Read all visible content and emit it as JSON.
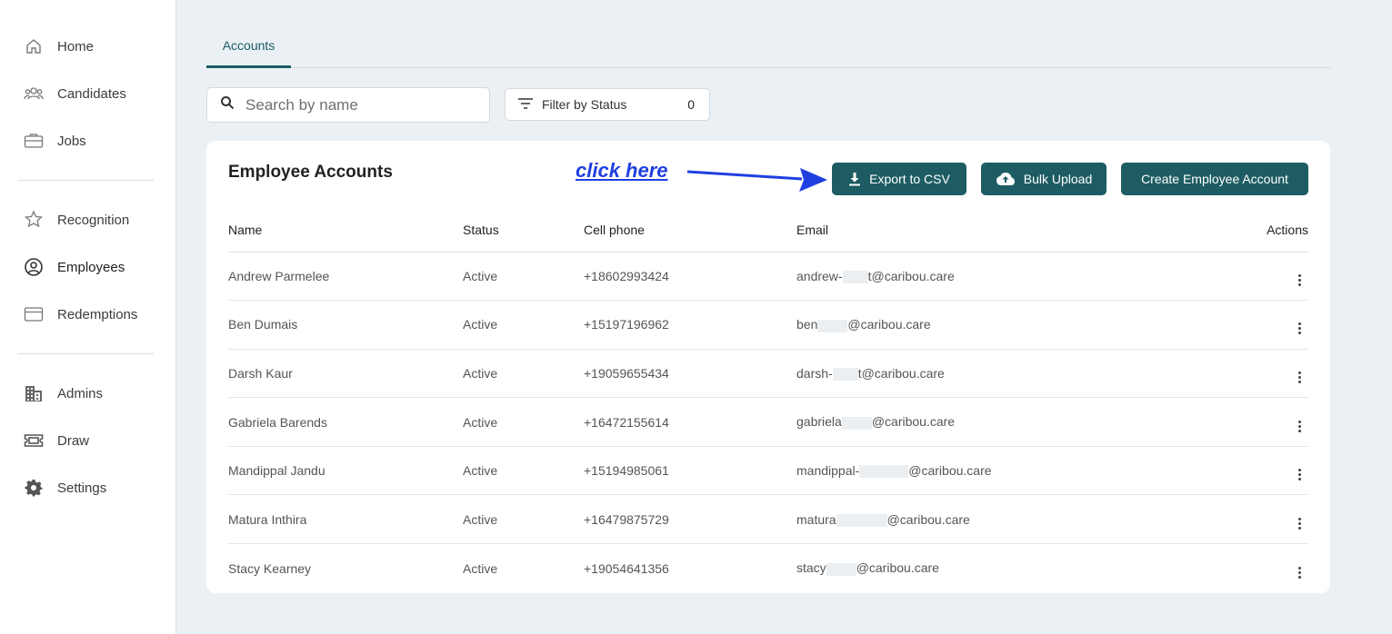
{
  "sidebar": {
    "items": [
      {
        "label": "Home",
        "icon": "home-icon"
      },
      {
        "label": "Candidates",
        "icon": "people-icon"
      },
      {
        "label": "Jobs",
        "icon": "briefcase-icon"
      },
      {
        "label": "Recognition",
        "icon": "star-badge-icon"
      },
      {
        "label": "Employees",
        "icon": "account-circle-icon"
      },
      {
        "label": "Redemptions",
        "icon": "credit-card-icon"
      },
      {
        "label": "Admins",
        "icon": "building-icon"
      },
      {
        "label": "Draw",
        "icon": "ticket-icon"
      },
      {
        "label": "Settings",
        "icon": "gear-icon"
      }
    ]
  },
  "tabs": [
    {
      "label": "Accounts"
    }
  ],
  "search": {
    "placeholder": "Search by name",
    "value": ""
  },
  "filter": {
    "label": "Filter by Status",
    "count": "0"
  },
  "card": {
    "title": "Employee Accounts",
    "annotation": "click here",
    "buttons": {
      "export": "Export to CSV",
      "bulk": "Bulk Upload",
      "create": "Create Employee Account"
    },
    "columns": {
      "name": "Name",
      "status": "Status",
      "phone": "Cell phone",
      "email": "Email",
      "actions": "Actions"
    },
    "rows": [
      {
        "name": "Andrew Parmelee",
        "status": "Active",
        "phone": "+18602993424",
        "email_start": "andrew-",
        "email_end": "t@caribou.care"
      },
      {
        "name": "Ben Dumais",
        "status": "Active",
        "phone": "+15197196962",
        "email_start": "ben",
        "email_end": "@caribou.care"
      },
      {
        "name": "Darsh Kaur",
        "status": "Active",
        "phone": "+19059655434",
        "email_start": "darsh-",
        "email_end": "t@caribou.care"
      },
      {
        "name": "Gabriela Barends",
        "status": "Active",
        "phone": "+16472155614",
        "email_start": "gabriela",
        "email_end": "@caribou.care"
      },
      {
        "name": "Mandippal Jandu",
        "status": "Active",
        "phone": "+15194985061",
        "email_start": "mandippal-",
        "email_end": "@caribou.care"
      },
      {
        "name": "Matura Inthira",
        "status": "Active",
        "phone": "+16479875729",
        "email_start": "matura",
        "email_end": "@caribou.care"
      },
      {
        "name": "Stacy Kearney",
        "status": "Active",
        "phone": "+19054641356",
        "email_start": "stacy",
        "email_end": "@caribou.care"
      }
    ]
  },
  "colors": {
    "accent": "#1d5c63",
    "annotation": "#1f3fe0",
    "background": "#eaf0f4"
  }
}
